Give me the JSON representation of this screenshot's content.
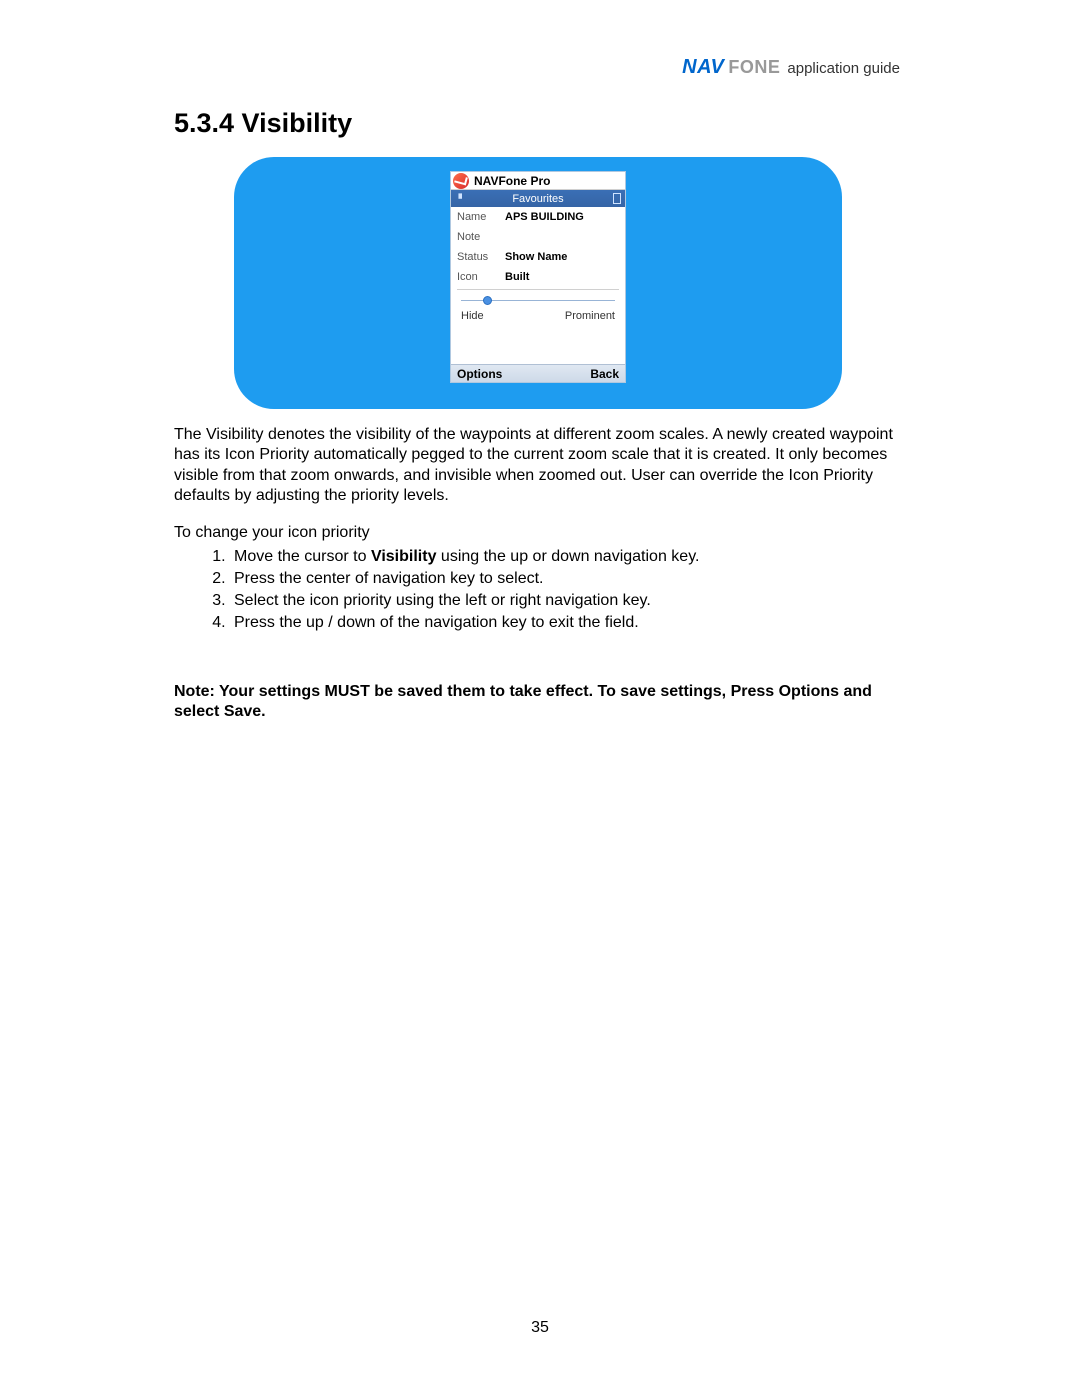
{
  "header": {
    "logo_nav": "NAV",
    "logo_fone": "FONE",
    "subtitle": "application guide"
  },
  "section": {
    "number_title": "5.3.4 Visibility"
  },
  "phone": {
    "app_name": "NAVFone Pro",
    "screen_title": "Favourites",
    "fields": {
      "name_label": "Name",
      "name_value": "APS BUILDING",
      "note_label": "Note",
      "note_value": "",
      "status_label": "Status",
      "status_value": "Show Name",
      "icon_label": "Icon",
      "icon_value": "Built"
    },
    "slider": {
      "left_label": "Hide",
      "right_label": "Prominent"
    },
    "softkeys": {
      "left": "Options",
      "right": "Back"
    }
  },
  "paragraph": "The Visibility denotes the visibility of the waypoints at different zoom scales. A newly created waypoint has its Icon Priority automatically pegged to the current zoom scale that it is created. It only becomes visible from that zoom onwards, and invisible when zoomed out. User can override the Icon Priority defaults by adjusting the priority levels.",
  "lead": "To change your icon priority",
  "steps": {
    "s1_a": "Move the cursor to ",
    "s1_b": "Visibility",
    "s1_c": " using the up or down navigation key.",
    "s2": "Press the center of navigation key to select.",
    "s3": "Select the icon priority using the left or right navigation key.",
    "s4": "Press the up / down of the navigation key to exit the field."
  },
  "note": "Note: Your settings MUST be saved them to take effect. To save settings, Press Options and select Save.",
  "page_number": "35"
}
